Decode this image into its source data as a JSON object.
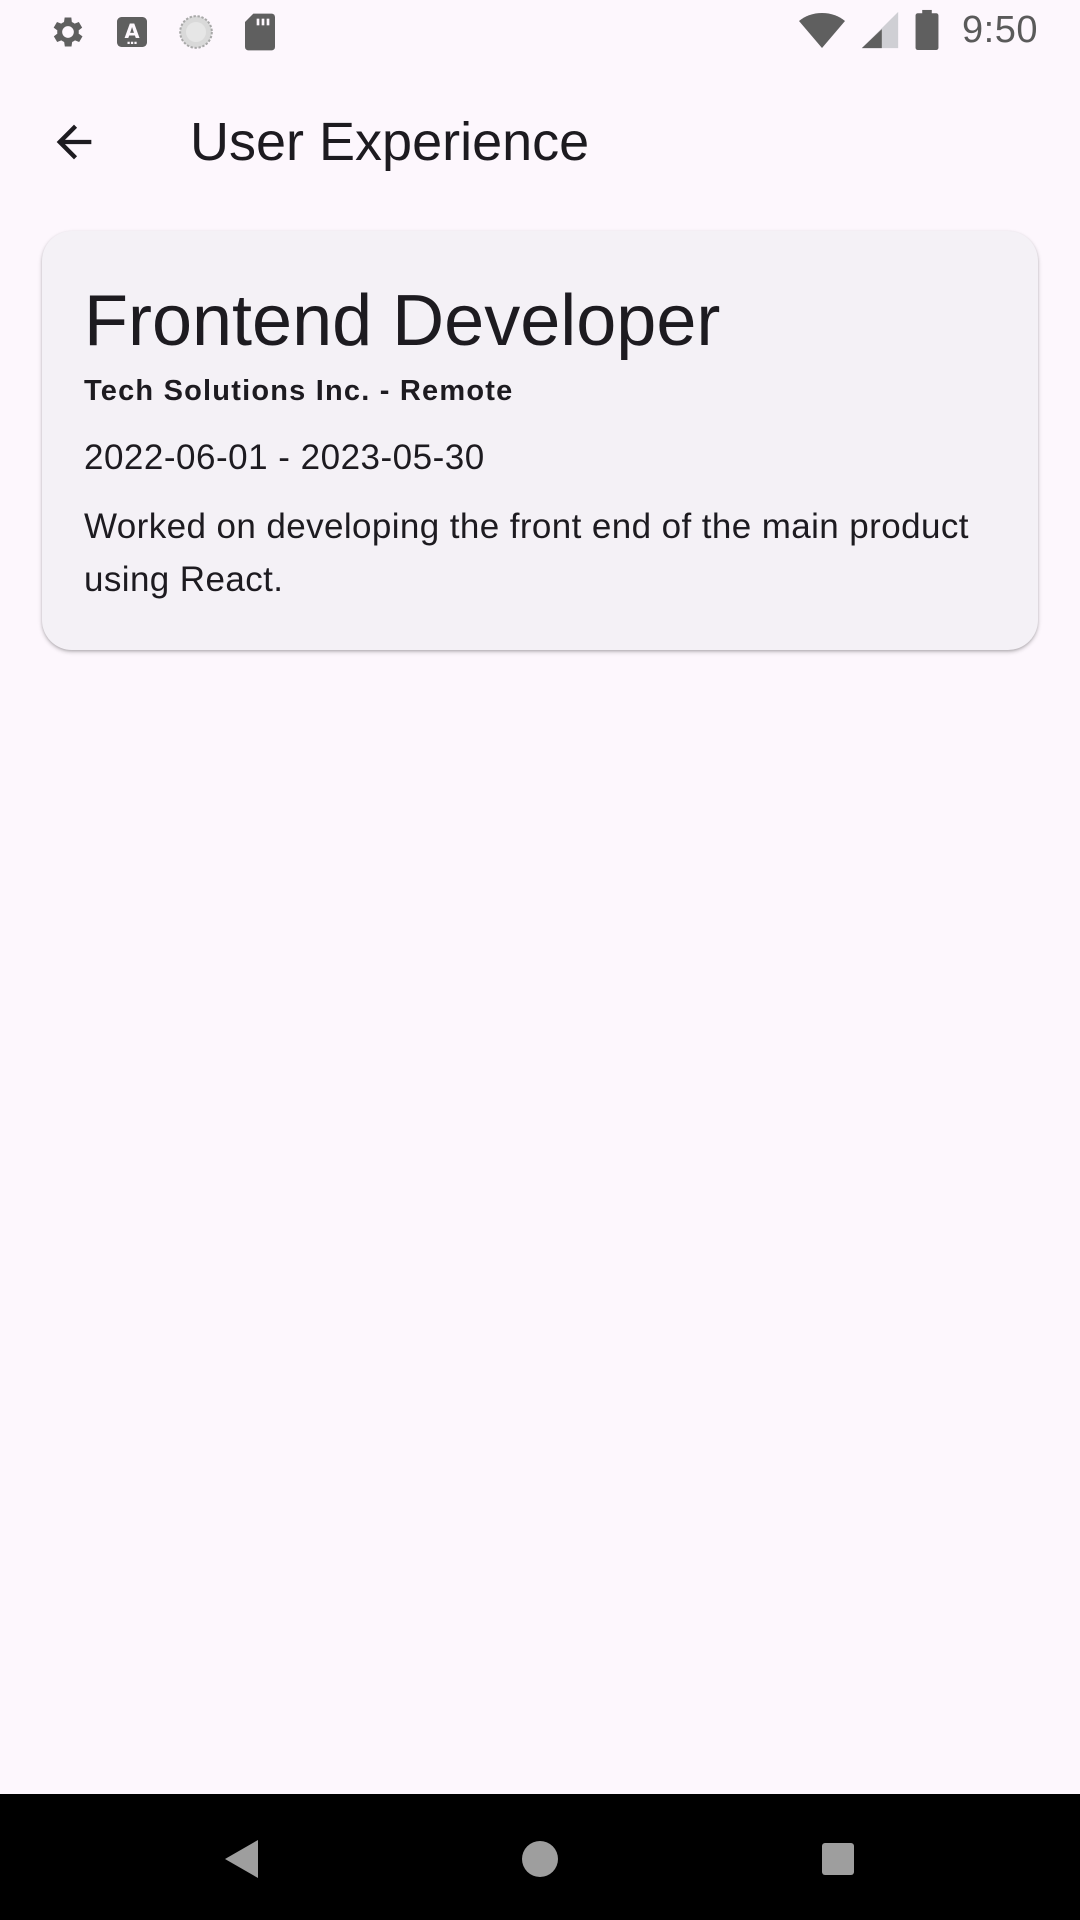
{
  "status_bar": {
    "time": "9:50",
    "left_icons": [
      "settings-icon",
      "text-a-icon",
      "loading-circle-icon",
      "sd-card-icon"
    ],
    "right_icons": [
      "wifi-icon",
      "signal-icon",
      "battery-icon"
    ]
  },
  "app_bar": {
    "title": "User Experience",
    "back_icon": "arrow-back-icon"
  },
  "experience": {
    "job_title": "Frontend Developer",
    "company_location": "Tech Solutions Inc. - Remote",
    "date_range": "2022-06-01 - 2023-05-30",
    "description": "Worked on developing the front end of the main product using React."
  },
  "nav_bar": {
    "buttons": [
      "back-triangle-icon",
      "home-circle-icon",
      "recents-square-icon"
    ]
  },
  "colors": {
    "background": "#fdf7fd",
    "card": "#f4f1f6",
    "text": "#1d1b20",
    "status_icons": "#5a5a5a",
    "nav_background": "#000000"
  }
}
